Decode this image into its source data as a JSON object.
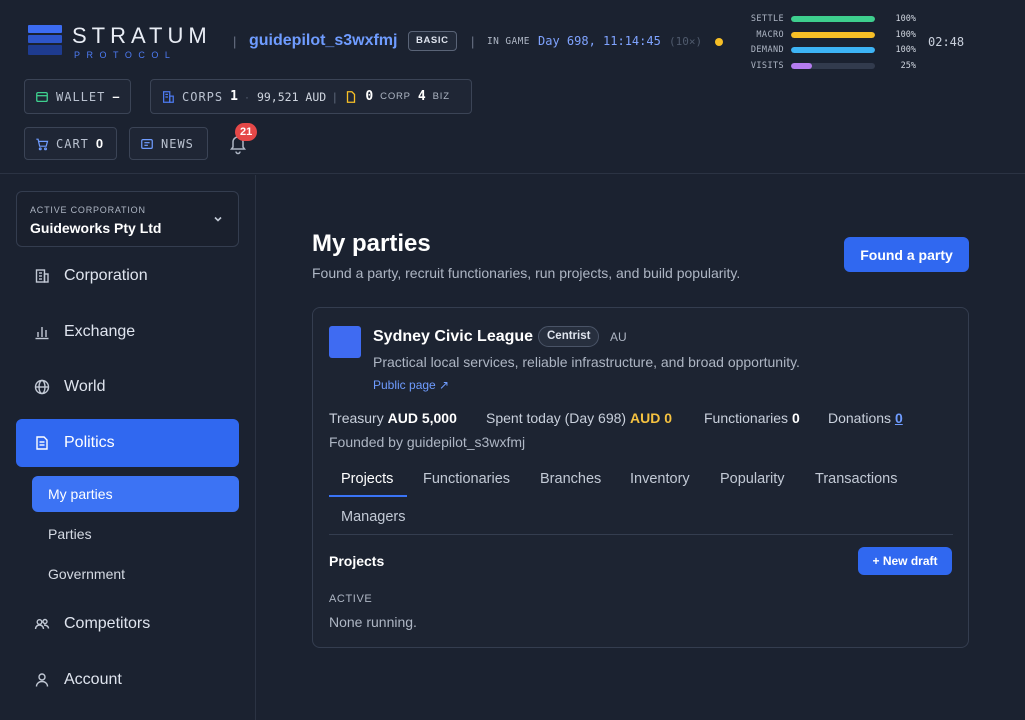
{
  "header": {
    "brand_name": "STRATUM",
    "brand_sub": "PROTOCOL",
    "username": "guidepilot_s3wxfmj",
    "tier": "BASIC",
    "ingame_label": "IN GAME",
    "game_date": "Day 698, 11:14:45",
    "speed": "(10×)",
    "clock": "02:48",
    "separator": "|",
    "meters": [
      {
        "label": "SETTLE",
        "value": "100%",
        "percent": 100,
        "color": "#3ecf8e"
      },
      {
        "label": "MACRO",
        "value": "100%",
        "percent": 100,
        "color": "#f7bf26"
      },
      {
        "label": "DEMAND",
        "value": "100%",
        "percent": 100,
        "color": "#3db4f5"
      },
      {
        "label": "VISITS",
        "value": "25%",
        "percent": 25,
        "color": "#b57cf0"
      }
    ],
    "wallet": {
      "label": "WALLET",
      "value": "–"
    },
    "corps": {
      "label": "CORPS",
      "count": "1",
      "sep": "·",
      "amount": "99,521 AUD",
      "divider": "|",
      "corp_count": "0",
      "corp_label": "CORP",
      "biz_count": "4",
      "biz_label": "BIZ"
    },
    "cart": {
      "label": "CART",
      "count": "0"
    },
    "news": {
      "label": "NEWS"
    },
    "notifications": {
      "count": "21"
    }
  },
  "sidebar": {
    "corp_switch": {
      "label": "ACTIVE CORPORATION",
      "name": "Guideworks Pty Ltd"
    },
    "nav": [
      {
        "label": "Corporation",
        "icon": "building-icon"
      },
      {
        "label": "Exchange",
        "icon": "bar-chart-icon"
      },
      {
        "label": "World",
        "icon": "globe-icon"
      },
      {
        "label": "Politics",
        "icon": "document-icon",
        "active": true
      },
      {
        "label": "Competitors",
        "icon": "users-icon"
      },
      {
        "label": "Account",
        "icon": "user-icon"
      }
    ],
    "politics_sub": [
      "My parties",
      "Parties",
      "Government"
    ]
  },
  "main": {
    "title": "My parties",
    "subtitle": "Found a party, recruit functionaries, run projects, and build popularity.",
    "found_button": "Found a party",
    "party": {
      "name": "Sydney Civic League",
      "ideology": "Centrist",
      "country": "AU",
      "color": "#3f6bf2",
      "description": "Practical local services, reliable infrastructure, and broad opportunity.",
      "public_link": "Public page ↗",
      "treasury_label": "Treasury",
      "treasury_value": "AUD 5,000",
      "spent_label": "Spent today (Day 698)",
      "spent_value": "AUD 0",
      "functionaries_label": "Functionaries",
      "functionaries_value": "0",
      "donations_label": "Donations",
      "donations_value": "0",
      "founded_by": "Founded by guidepilot_s3wxfmj"
    },
    "tabs": [
      "Projects",
      "Functionaries",
      "Branches",
      "Inventory",
      "Popularity",
      "Transactions",
      "Managers"
    ],
    "projects": {
      "heading": "Projects",
      "new_draft": "+ New draft",
      "active_label": "ACTIVE",
      "empty": "None running."
    }
  }
}
